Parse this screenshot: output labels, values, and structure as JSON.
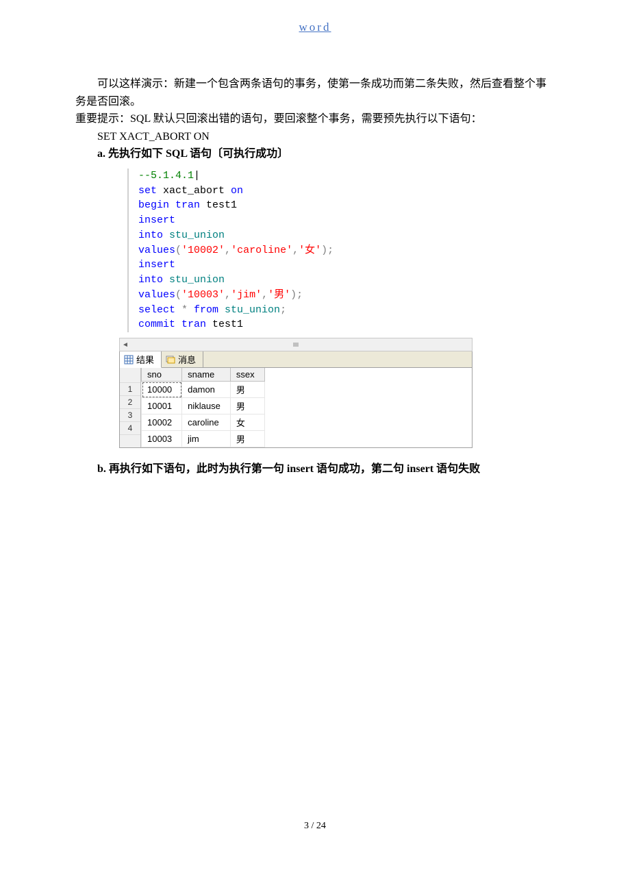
{
  "header": {
    "link": "word"
  },
  "body": {
    "p1": "可以这样演示：新建一个包含两条语句的事务，使第一条成功而第二条失败，然后查看整个事务是否回滚。",
    "p2_prefix": "重要提示：SQL 默认只回滚出错的语句，要回滚整个事务，需要预先执行以下语句：",
    "set_stmt": "SET XACT_ABORT ON",
    "step_a_label": "a.",
    "step_a_text": "先执行如下 SQL 语句〔可执行成功〕",
    "step_b_label": "b.",
    "step_b_text": "再执行如下语句，此时为执行第一句 insert 语句成功，第二句 insert 语句失败"
  },
  "sql": {
    "comment": "--5.1.4.1",
    "l1_a": "set",
    "l1_b": " xact_abort ",
    "l1_c": "on",
    "l2_a": "begin",
    "l2_b": " tran",
    "l2_c": " test1",
    "l3": "insert",
    "l4_a": "into",
    "l4_b": " stu_union",
    "l5_a": "values",
    "l5_b": "(",
    "l5_c": "'10002'",
    "l5_d": ",",
    "l5_e": "'caroline'",
    "l5_f": ",",
    "l5_g": "'女'",
    "l5_h": ");",
    "l6": "insert",
    "l7_a": "into",
    "l7_b": " stu_union",
    "l8_a": "values",
    "l8_b": "(",
    "l8_c": "'10003'",
    "l8_d": ",",
    "l8_e": "'jim'",
    "l8_f": ",",
    "l8_g": "'男'",
    "l8_h": ");",
    "l9_a": "select",
    "l9_b": " *",
    "l9_c": " from",
    "l9_d": " stu_union",
    "l9_e": ";",
    "l10_a": "commit",
    "l10_b": " tran",
    "l10_c": " test1"
  },
  "tabs": {
    "results": "结果",
    "messages": "消息"
  },
  "table": {
    "cols": [
      "sno",
      "sname",
      "ssex"
    ],
    "rows": [
      {
        "n": "1",
        "sno": "10000",
        "sname": "damon",
        "ssex": "男"
      },
      {
        "n": "2",
        "sno": "10001",
        "sname": "niklause",
        "ssex": "男"
      },
      {
        "n": "3",
        "sno": "10002",
        "sname": "caroline",
        "ssex": "女"
      },
      {
        "n": "4",
        "sno": "10003",
        "sname": "jim",
        "ssex": "男"
      }
    ]
  },
  "footer": {
    "page": "3  /  24"
  }
}
